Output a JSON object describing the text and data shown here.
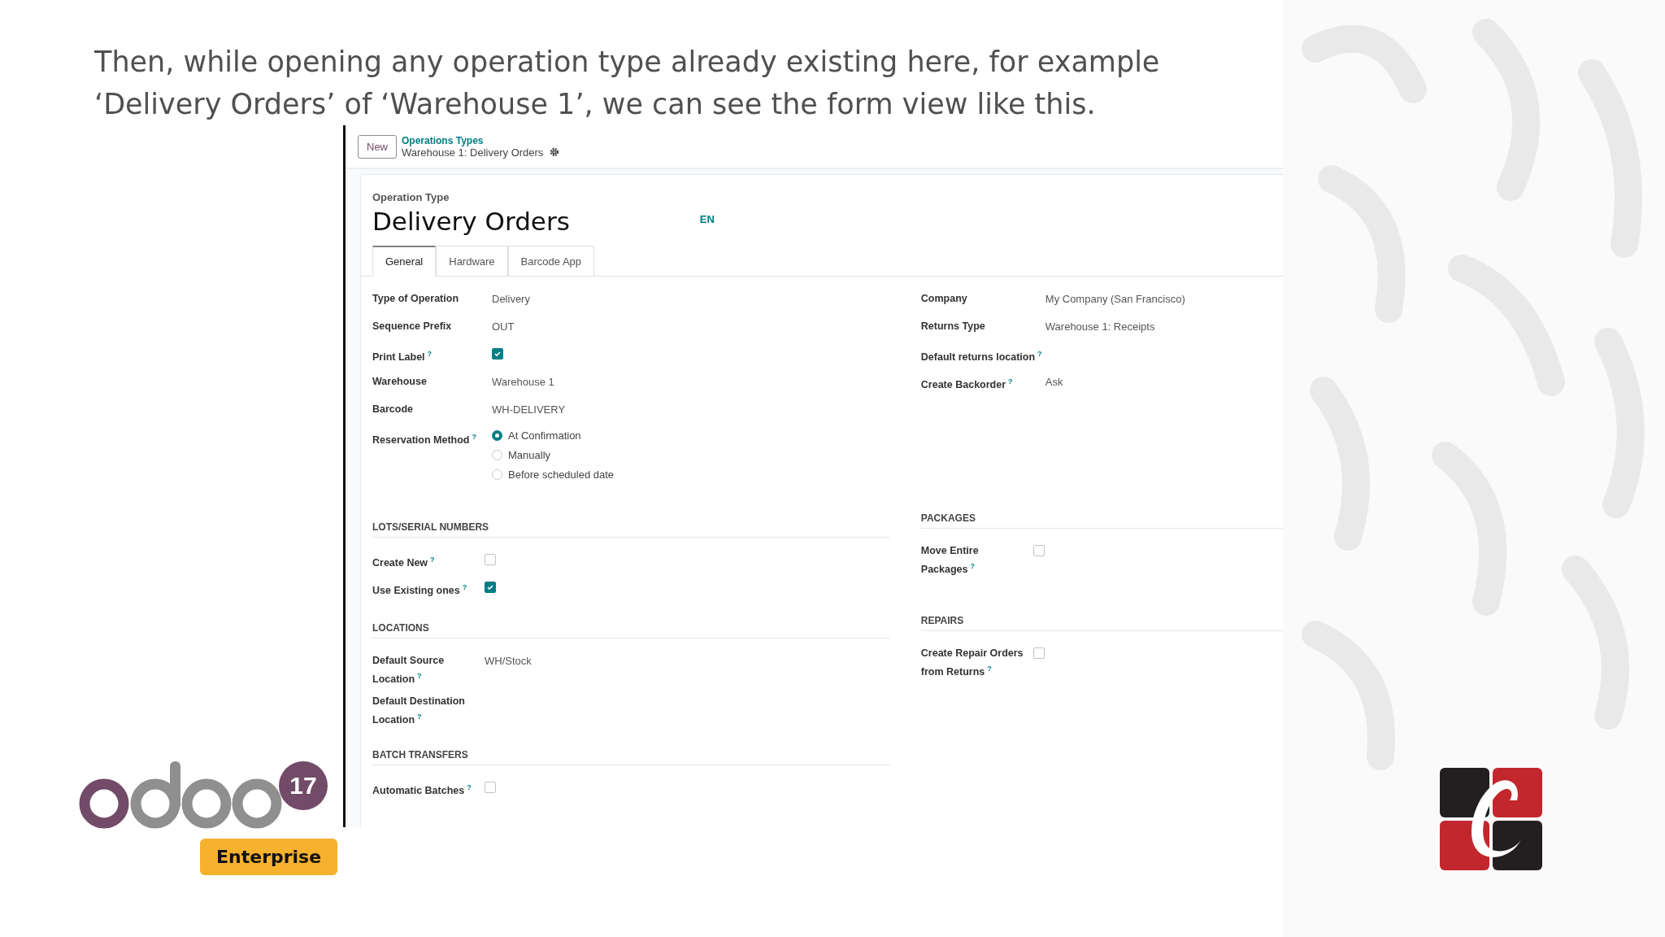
{
  "caption": "Then, while opening any operation type already existing here, for example ‘Delivery Orders’ of ‘Warehouse 1’, we can see the form view like this.",
  "breadcrumb": {
    "new_button": "New",
    "parent": "Operations Types",
    "current": "Warehouse 1: Delivery Orders"
  },
  "form": {
    "record_label": "Operation Type",
    "title": "Delivery Orders",
    "language": "EN",
    "tabs": [
      {
        "label": "General",
        "selected": true
      },
      {
        "label": "Hardware",
        "selected": false
      },
      {
        "label": "Barcode App",
        "selected": false
      }
    ],
    "left_fields": [
      {
        "kind": "text",
        "label": "Type of Operation",
        "value": "Delivery"
      },
      {
        "kind": "text",
        "label": "Sequence Prefix",
        "value": "OUT"
      },
      {
        "kind": "checkbox",
        "label": "Print Label",
        "help": "?",
        "checked": true
      },
      {
        "kind": "text",
        "label": "Warehouse",
        "value": "Warehouse 1"
      },
      {
        "kind": "text",
        "label": "Barcode",
        "value": "WH-DELIVERY"
      },
      {
        "kind": "radio",
        "label": "Reservation Method",
        "help": "?",
        "options": [
          {
            "label": "At Confirmation",
            "selected": true
          },
          {
            "label": "Manually",
            "selected": false
          },
          {
            "label": "Before scheduled date",
            "selected": false
          }
        ]
      }
    ],
    "right_fields": [
      {
        "kind": "text",
        "label": "Company",
        "value": "My Company (San Francisco)"
      },
      {
        "kind": "text",
        "label": "Returns Type",
        "value": "Warehouse 1: Receipts"
      },
      {
        "kind": "text",
        "label": "Default returns location",
        "help": "?"
      },
      {
        "kind": "text",
        "label": "Create Backorder",
        "help": "?",
        "value": "Ask"
      }
    ],
    "left_sections": [
      {
        "title": "LOTS/SERIAL NUMBERS",
        "fields": [
          {
            "kind": "checkbox",
            "label": "Create New",
            "help": "?",
            "checked": false
          },
          {
            "kind": "checkbox",
            "label": "Use Existing ones",
            "help": "?",
            "checked": true
          }
        ]
      },
      {
        "title": "LOCATIONS",
        "fields": [
          {
            "kind": "text",
            "label": "Default Source Location",
            "help": "?",
            "value": "WH/Stock"
          },
          {
            "kind": "text",
            "label": "Default Destination Location",
            "help": "?"
          }
        ]
      },
      {
        "title": "BATCH TRANSFERS",
        "fields": [
          {
            "kind": "checkbox",
            "label": "Automatic Batches",
            "help": "?",
            "checked": false
          }
        ]
      }
    ],
    "right_sections": [
      {
        "title": "PACKAGES",
        "fields": [
          {
            "kind": "checkbox",
            "label": "Move Entire Packages",
            "help": "?",
            "checked": false
          }
        ]
      },
      {
        "title": "REPAIRS",
        "fields": [
          {
            "kind": "checkbox",
            "label": "Create Repair Orders from Returns",
            "help": "?",
            "checked": false
          }
        ]
      }
    ]
  },
  "version_badge": "17",
  "edition_badge": "Enterprise"
}
